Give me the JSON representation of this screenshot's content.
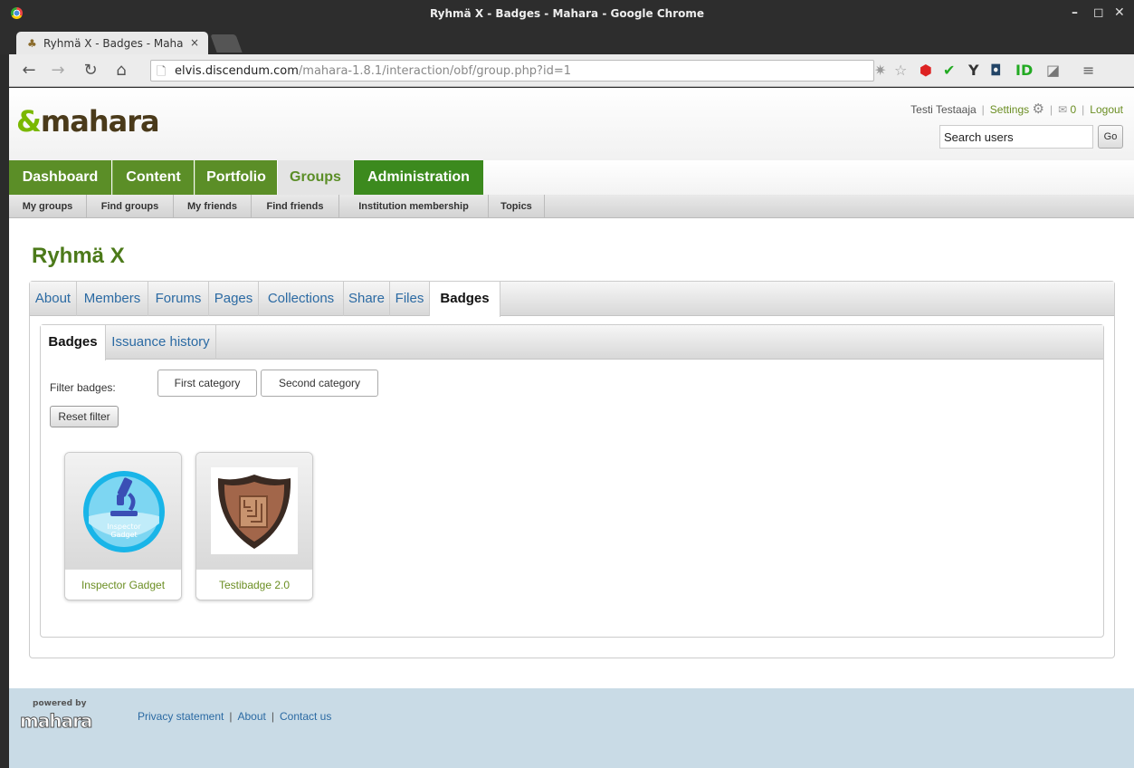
{
  "window": {
    "title": "Ryhmä X - Badges - Mahara - Google Chrome",
    "controls": [
      "–",
      "◻",
      "✕"
    ]
  },
  "tab": {
    "label": "Ryhmä X - Badges - Mahar",
    "close": "×"
  },
  "address": {
    "host": "elvis.discendum.com",
    "path": "/mahara-1.8.1/interaction/obf/group.php?id=1"
  },
  "header": {
    "logo": "mahara",
    "user": "Testi Testaaja",
    "settings": "Settings",
    "mail_count": "0",
    "logout": "Logout",
    "search_value": "Search users",
    "go": "Go"
  },
  "mainnav": {
    "items": [
      "Dashboard",
      "Content",
      "Portfolio",
      "Groups",
      "Administration"
    ]
  },
  "subnav": {
    "items": [
      "My groups",
      "Find groups",
      "My friends",
      "Find friends",
      "Institution membership",
      "Topics"
    ]
  },
  "group": {
    "title": "Ryhmä X",
    "tabs": [
      "About",
      "Members",
      "Forums",
      "Pages",
      "Collections",
      "Share",
      "Files",
      "Badges"
    ]
  },
  "badges_panel": {
    "tabs": [
      "Badges",
      "Issuance history"
    ],
    "filter_label": "Filter badges:",
    "filters": [
      "First category",
      "Second category"
    ],
    "reset": "Reset filter",
    "badges": [
      {
        "name": "Inspector Gadget",
        "img_text_1": "Inspector",
        "img_text_2": "Gadget",
        "icon": "microscope-icon"
      },
      {
        "name": "Testibadge 2.0",
        "icon": "maze-shield-icon"
      }
    ]
  },
  "footer": {
    "powered_by": "powered by",
    "logo": "mahara",
    "links": [
      "Privacy statement",
      "About",
      "Contact us"
    ]
  },
  "colors": {
    "nav_green": "#5b8e27",
    "link_blue": "#2b6aa3",
    "footer_bg": "#c9dbe6"
  }
}
